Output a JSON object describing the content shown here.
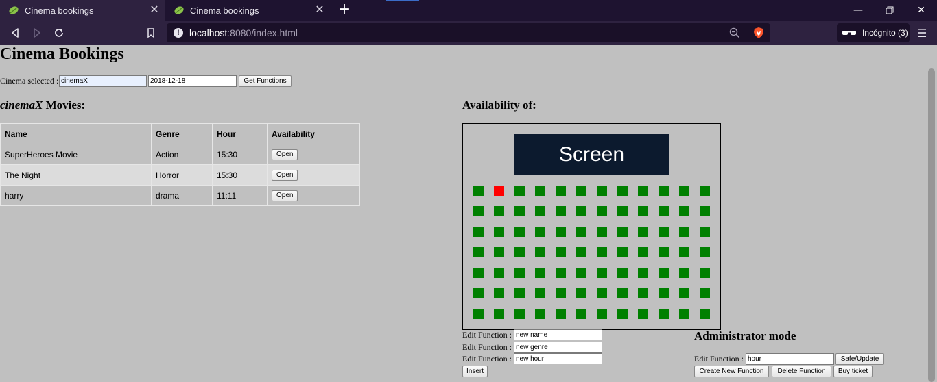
{
  "browser": {
    "tabs": [
      {
        "title": "Cinema bookings",
        "active": true
      },
      {
        "title": "Cinema bookings",
        "active": false
      }
    ],
    "new_tab_symbol": "+",
    "url_host": "localhost",
    "url_rest": ":8080/index.html",
    "incognito_label": "Incógnito (3)",
    "window_controls": [
      "minimize",
      "restore",
      "close"
    ]
  },
  "page": {
    "title": "Cinema Bookings",
    "cinema_selected_label": "Cinema selected :",
    "cinema_value": "cinemaX",
    "date_value": "2018-12-18",
    "get_functions_label": "Get Functions",
    "movies_heading_name": "cinemaX",
    "movies_heading_suffix": " Movies:",
    "table": {
      "headers": [
        "Name",
        "Genre",
        "Hour",
        "Availability"
      ],
      "rows": [
        {
          "name": "SuperHeroes Movie",
          "genre": "Action",
          "hour": "15:30",
          "action": "Open"
        },
        {
          "name": "The Night",
          "genre": "Horror",
          "hour": "15:30",
          "action": "Open"
        },
        {
          "name": "harry",
          "genre": "drama",
          "hour": "11:11",
          "action": "Open"
        }
      ]
    },
    "availability_heading": "Availability of:",
    "screen_label": "Screen",
    "seats": {
      "rows": 7,
      "cols": 12,
      "taken": [
        [
          0,
          1
        ]
      ],
      "available_color": "#008000",
      "taken_color": "#ff0000"
    },
    "edit_function": {
      "label": "Edit Function :",
      "name_value": "new name",
      "genre_value": "new genre",
      "hour_value": "new hour",
      "insert_label": "Insert"
    },
    "admin": {
      "heading": "Administrator mode",
      "edit_label": "Edit Function :",
      "hour_value": "hour",
      "safe_update_label": "Safe/Update",
      "create_label": "Create New Function",
      "delete_label": "Delete Function",
      "buy_label": "Buy ticket"
    }
  }
}
